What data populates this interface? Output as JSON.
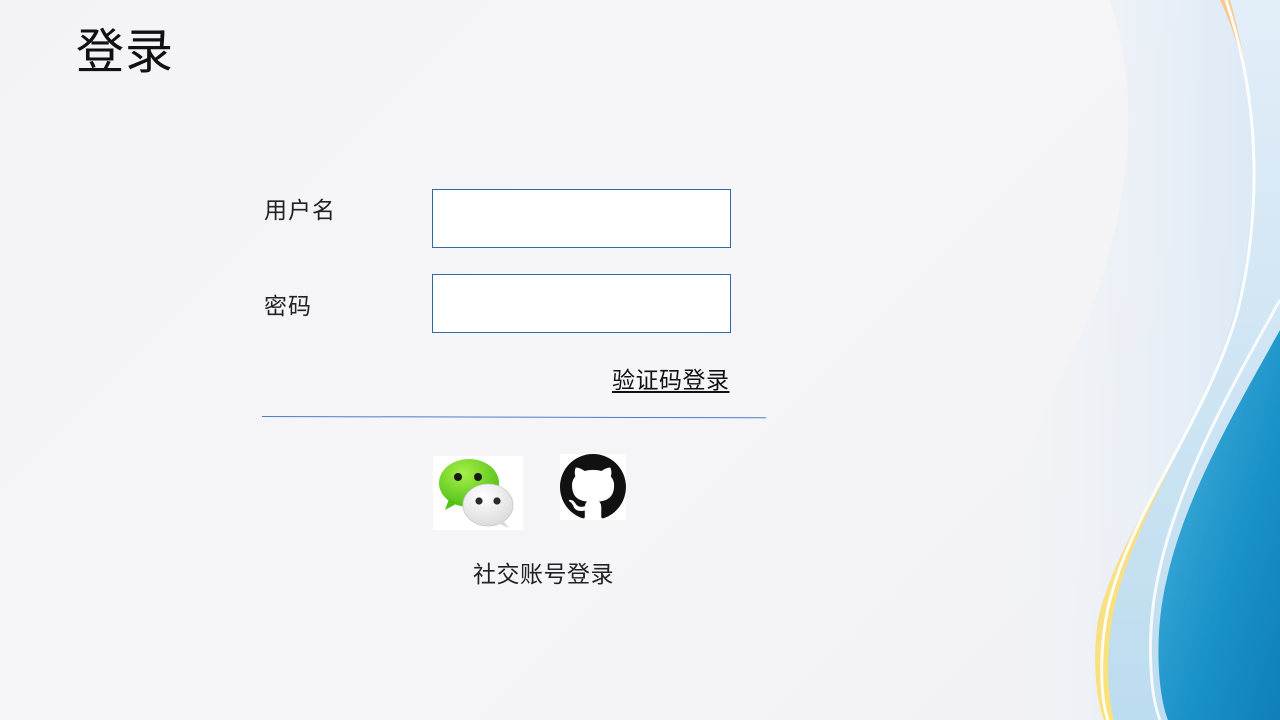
{
  "page": {
    "title": "登录"
  },
  "form": {
    "username_label": "用户名",
    "username_value": "",
    "password_label": "密码",
    "password_value": "",
    "code_login_link": "验证码登录"
  },
  "social": {
    "label": "社交账号登录",
    "buttons": [
      {
        "icon": "wechat-icon"
      },
      {
        "icon": "github-icon"
      }
    ]
  },
  "colors": {
    "input_border": "#2e6aa8",
    "divider": "#4a7fc0",
    "wechat_green": "#5fd31e",
    "wave_blue": "#1597cf",
    "wave_yellow": "#f6d47a"
  }
}
